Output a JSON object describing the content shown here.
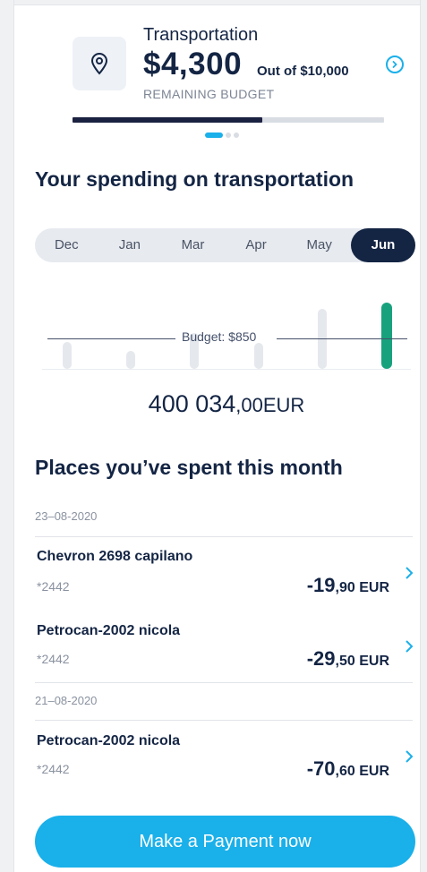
{
  "budget": {
    "icon": "location-pin-icon",
    "category": "Transportation",
    "remaining_amount": "$4,300",
    "out_of": "Out of $10,000",
    "remaining_label": "REMAINING BUDGET",
    "progress_fraction": 0.61,
    "next_icon": "chevron-right-circle-icon"
  },
  "pagination": {
    "pages": 3,
    "active": 0
  },
  "spending": {
    "title": "Your spending on transportation",
    "months": [
      "Dec",
      "Jan",
      "Mar",
      "Apr",
      "May",
      "Jun"
    ],
    "selected_month": "Jun",
    "budget_label": "Budget: $850",
    "total": {
      "main": "400 034",
      "cents": ",00EUR"
    }
  },
  "chart_data": {
    "type": "bar",
    "categories": [
      "Dec",
      "Jan",
      "Mar",
      "Apr",
      "May",
      "Jun"
    ],
    "values": [
      440,
      220,
      600,
      430,
      1000,
      1100
    ],
    "reference_line": 850,
    "selected": "Jun",
    "colors": {
      "bar": "#e5e8ed",
      "selected": "#17a27d",
      "budget_line": "#44506a"
    }
  },
  "places": {
    "title": "Places you’ve spent this month",
    "groups": [
      {
        "date": "23–08-2020",
        "transactions": [
          {
            "name": "Chevron 2698 capilano",
            "card": "*2442",
            "amount_main": "-19",
            "amount_rest": ",90 EUR"
          },
          {
            "name": "Petrocan-2002 nicola",
            "card": "*2442",
            "amount_main": "-29",
            "amount_rest": ",50 EUR"
          }
        ]
      },
      {
        "date": "21–08-2020",
        "transactions": [
          {
            "name": "Petrocan-2002 nicola",
            "card": "*2442",
            "amount_main": "-70",
            "amount_rest": ",60 EUR"
          }
        ]
      }
    ]
  },
  "actions": {
    "pay_label": "Make a Payment now"
  },
  "colors": {
    "primary": "#1ab0ea",
    "navy": "#142544",
    "accent_green": "#17a27d"
  }
}
